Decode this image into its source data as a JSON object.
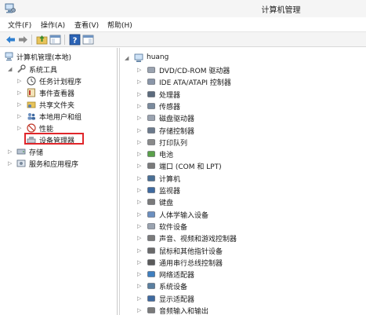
{
  "window": {
    "title": "计算机管理"
  },
  "menu": {
    "items": [
      "文件(F)",
      "操作(A)",
      "查看(V)",
      "帮助(H)"
    ]
  },
  "toolbar": {
    "buttons": [
      "back-arrow-icon",
      "forward-arrow-icon",
      "up-folder-icon",
      "show-pane-icon",
      "help-icon",
      "properties-pane-icon"
    ]
  },
  "left_tree": {
    "root": "计算机管理(本地)",
    "system_tools": "系统工具",
    "items": [
      "任务计划程序",
      "事件查看器",
      "共享文件夹",
      "本地用户和组",
      "性能",
      "设备管理器"
    ],
    "storage": "存储",
    "services": "服务和应用程序"
  },
  "right_tree": {
    "root": "huang",
    "items": [
      "DVD/CD-ROM 驱动器",
      "IDE ATA/ATAPI 控制器",
      "处理器",
      "传感器",
      "磁盘驱动器",
      "存储控制器",
      "打印队列",
      "电池",
      "端口 (COM 和 LPT)",
      "计算机",
      "监视器",
      "键盘",
      "人体学输入设备",
      "软件设备",
      "声音、视频和游戏控制器",
      "鼠标和其他指针设备",
      "通用串行总线控制器",
      "网络适配器",
      "系统设备",
      "显示适配器",
      "音频输入和输出"
    ]
  },
  "colors": {
    "highlight": "#e0262b",
    "accent": "#1f6fb5"
  }
}
